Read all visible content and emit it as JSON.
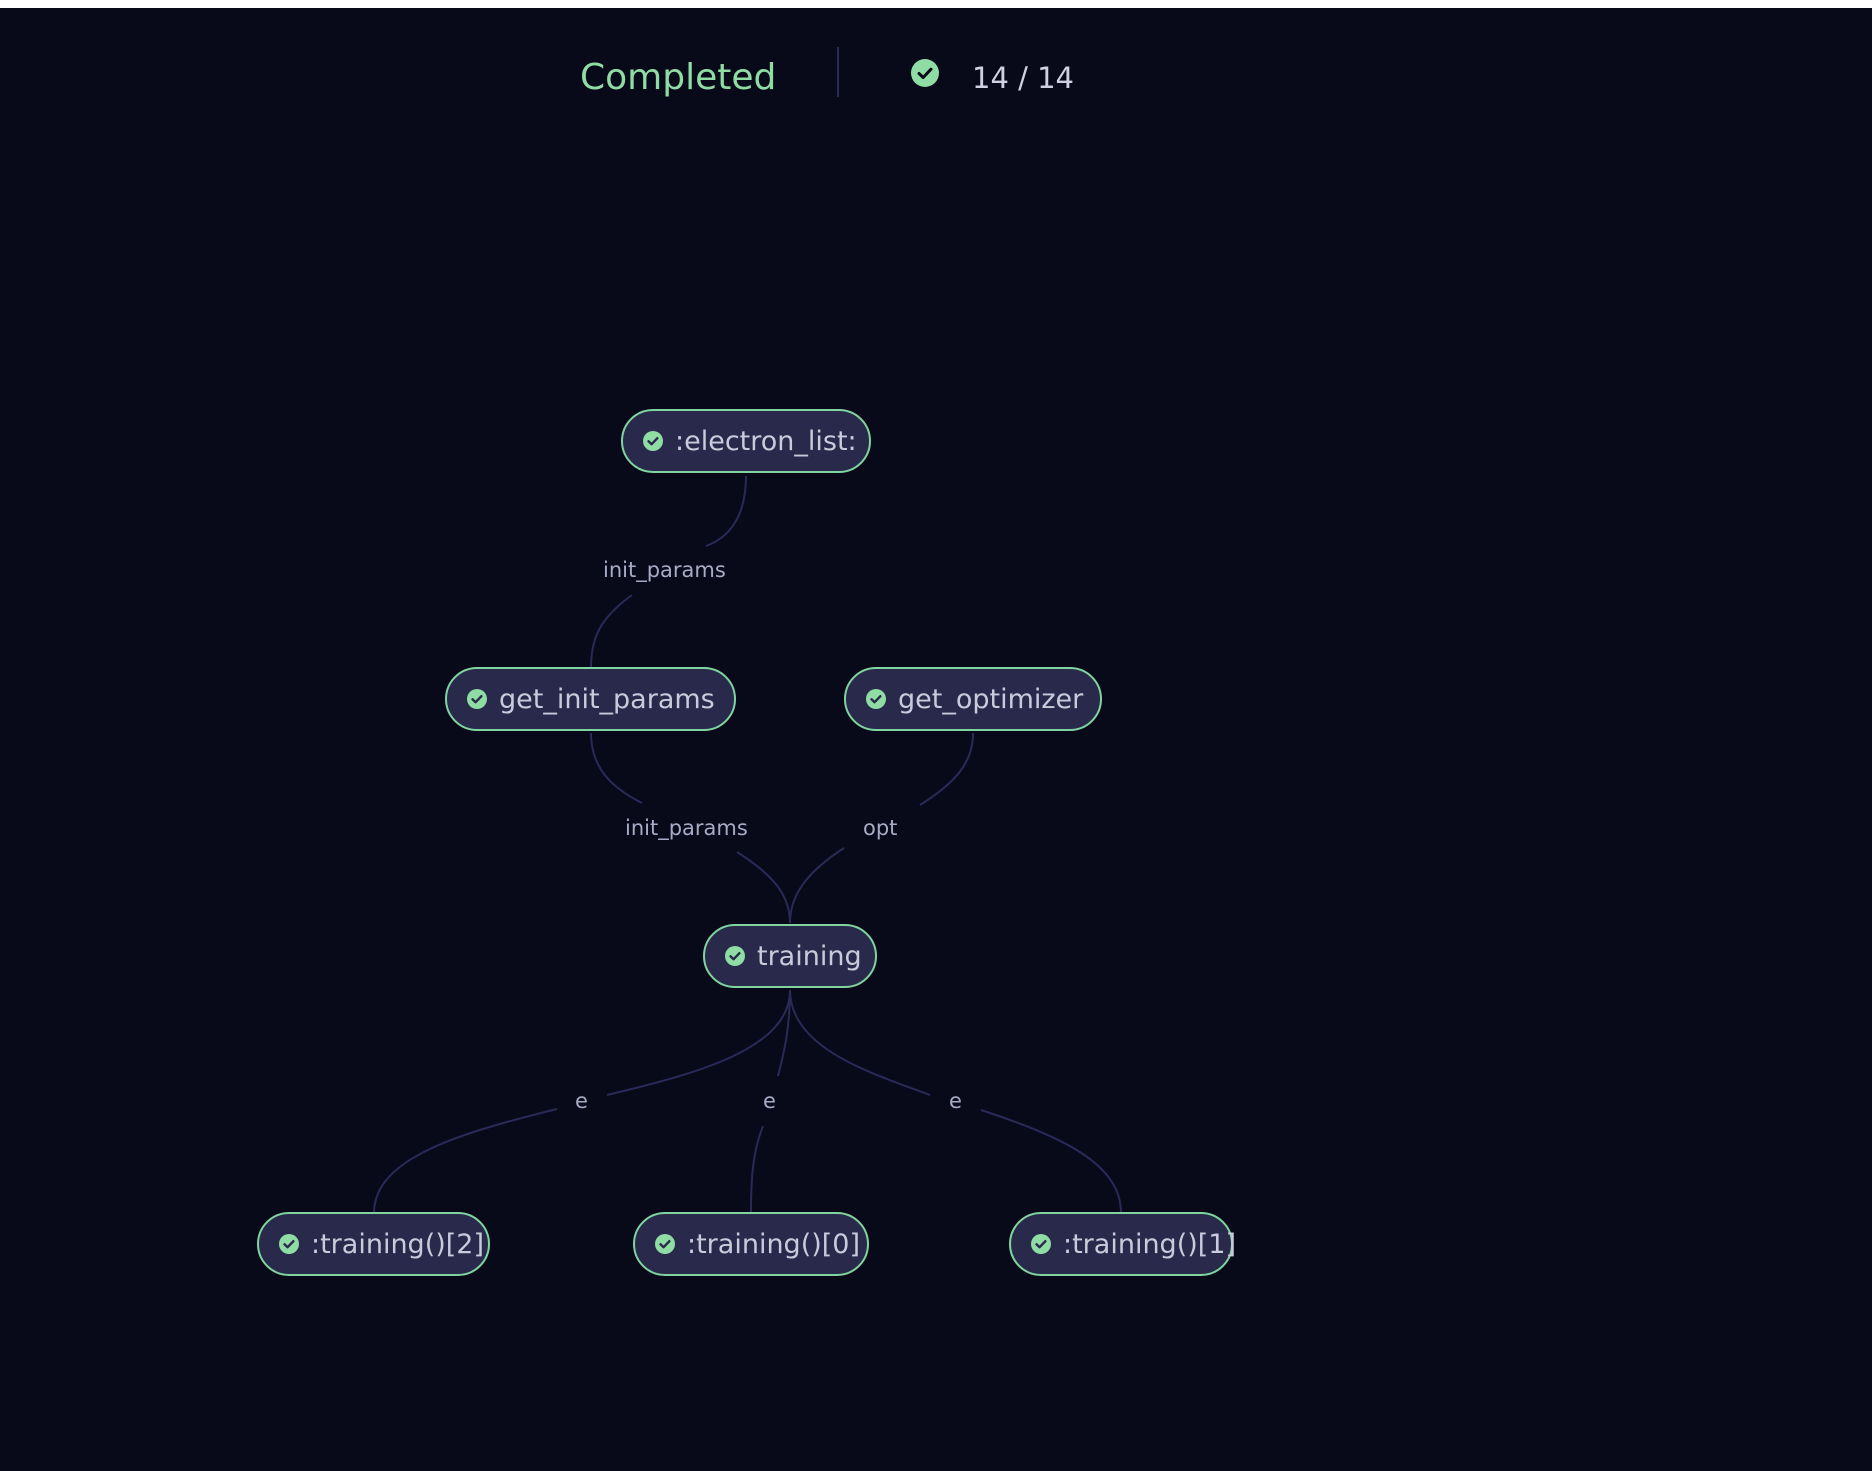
{
  "status": {
    "title": "Completed",
    "progress_text": "14 / 14",
    "progress_done": 14,
    "progress_total": 14,
    "progress_icon": "check-circle-icon"
  },
  "colors": {
    "background": "#080919",
    "accent_green": "#8fdca4",
    "node_fill": "#29294b",
    "node_border": "#7fd4a0",
    "edge": "#2a2a58",
    "label_text": "#a9abc6"
  },
  "graph": {
    "nodes": [
      {
        "id": "electron_list",
        "label": ":electron_list:",
        "status": "completed"
      },
      {
        "id": "get_init_params",
        "label": "get_init_params",
        "status": "completed"
      },
      {
        "id": "get_optimizer",
        "label": "get_optimizer",
        "status": "completed"
      },
      {
        "id": "training",
        "label": "training",
        "status": "completed"
      },
      {
        "id": "training_2",
        "label": ":training()[2]",
        "status": "completed"
      },
      {
        "id": "training_0",
        "label": ":training()[0]",
        "status": "completed"
      },
      {
        "id": "training_1",
        "label": ":training()[1]",
        "status": "completed"
      }
    ],
    "edges": [
      {
        "from": "electron_list",
        "to": "get_init_params",
        "label": "init_params"
      },
      {
        "from": "get_init_params",
        "to": "training",
        "label": "init_params"
      },
      {
        "from": "get_optimizer",
        "to": "training",
        "label": "opt"
      },
      {
        "from": "training",
        "to": "training_2",
        "label": "e"
      },
      {
        "from": "training",
        "to": "training_0",
        "label": "e"
      },
      {
        "from": "training",
        "to": "training_1",
        "label": "e"
      }
    ]
  }
}
